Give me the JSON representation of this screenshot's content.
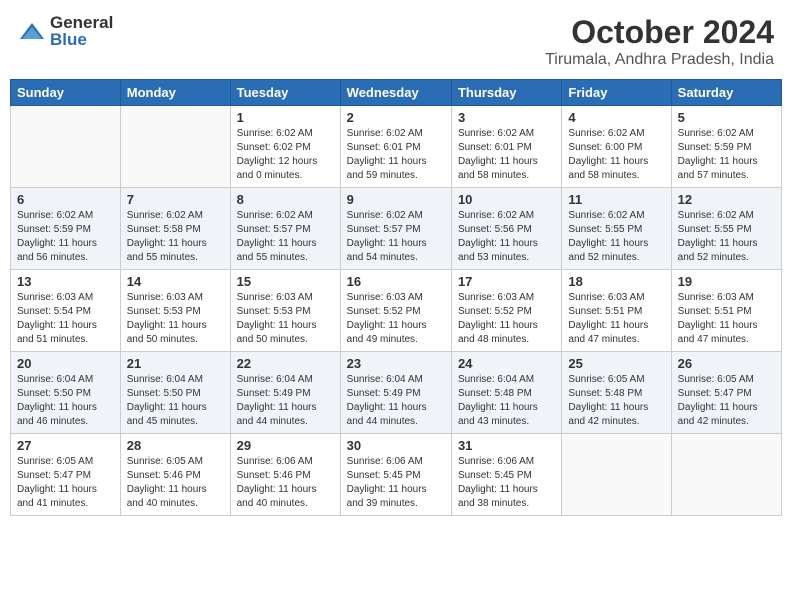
{
  "header": {
    "logo_general": "General",
    "logo_blue": "Blue",
    "month_title": "October 2024",
    "location": "Tirumala, Andhra Pradesh, India"
  },
  "weekdays": [
    "Sunday",
    "Monday",
    "Tuesday",
    "Wednesday",
    "Thursday",
    "Friday",
    "Saturday"
  ],
  "weeks": [
    [
      {
        "day": "",
        "info": ""
      },
      {
        "day": "",
        "info": ""
      },
      {
        "day": "1",
        "info": "Sunrise: 6:02 AM\nSunset: 6:02 PM\nDaylight: 12 hours\nand 0 minutes."
      },
      {
        "day": "2",
        "info": "Sunrise: 6:02 AM\nSunset: 6:01 PM\nDaylight: 11 hours\nand 59 minutes."
      },
      {
        "day": "3",
        "info": "Sunrise: 6:02 AM\nSunset: 6:01 PM\nDaylight: 11 hours\nand 58 minutes."
      },
      {
        "day": "4",
        "info": "Sunrise: 6:02 AM\nSunset: 6:00 PM\nDaylight: 11 hours\nand 58 minutes."
      },
      {
        "day": "5",
        "info": "Sunrise: 6:02 AM\nSunset: 5:59 PM\nDaylight: 11 hours\nand 57 minutes."
      }
    ],
    [
      {
        "day": "6",
        "info": "Sunrise: 6:02 AM\nSunset: 5:59 PM\nDaylight: 11 hours\nand 56 minutes."
      },
      {
        "day": "7",
        "info": "Sunrise: 6:02 AM\nSunset: 5:58 PM\nDaylight: 11 hours\nand 55 minutes."
      },
      {
        "day": "8",
        "info": "Sunrise: 6:02 AM\nSunset: 5:57 PM\nDaylight: 11 hours\nand 55 minutes."
      },
      {
        "day": "9",
        "info": "Sunrise: 6:02 AM\nSunset: 5:57 PM\nDaylight: 11 hours\nand 54 minutes."
      },
      {
        "day": "10",
        "info": "Sunrise: 6:02 AM\nSunset: 5:56 PM\nDaylight: 11 hours\nand 53 minutes."
      },
      {
        "day": "11",
        "info": "Sunrise: 6:02 AM\nSunset: 5:55 PM\nDaylight: 11 hours\nand 52 minutes."
      },
      {
        "day": "12",
        "info": "Sunrise: 6:02 AM\nSunset: 5:55 PM\nDaylight: 11 hours\nand 52 minutes."
      }
    ],
    [
      {
        "day": "13",
        "info": "Sunrise: 6:03 AM\nSunset: 5:54 PM\nDaylight: 11 hours\nand 51 minutes."
      },
      {
        "day": "14",
        "info": "Sunrise: 6:03 AM\nSunset: 5:53 PM\nDaylight: 11 hours\nand 50 minutes."
      },
      {
        "day": "15",
        "info": "Sunrise: 6:03 AM\nSunset: 5:53 PM\nDaylight: 11 hours\nand 50 minutes."
      },
      {
        "day": "16",
        "info": "Sunrise: 6:03 AM\nSunset: 5:52 PM\nDaylight: 11 hours\nand 49 minutes."
      },
      {
        "day": "17",
        "info": "Sunrise: 6:03 AM\nSunset: 5:52 PM\nDaylight: 11 hours\nand 48 minutes."
      },
      {
        "day": "18",
        "info": "Sunrise: 6:03 AM\nSunset: 5:51 PM\nDaylight: 11 hours\nand 47 minutes."
      },
      {
        "day": "19",
        "info": "Sunrise: 6:03 AM\nSunset: 5:51 PM\nDaylight: 11 hours\nand 47 minutes."
      }
    ],
    [
      {
        "day": "20",
        "info": "Sunrise: 6:04 AM\nSunset: 5:50 PM\nDaylight: 11 hours\nand 46 minutes."
      },
      {
        "day": "21",
        "info": "Sunrise: 6:04 AM\nSunset: 5:50 PM\nDaylight: 11 hours\nand 45 minutes."
      },
      {
        "day": "22",
        "info": "Sunrise: 6:04 AM\nSunset: 5:49 PM\nDaylight: 11 hours\nand 44 minutes."
      },
      {
        "day": "23",
        "info": "Sunrise: 6:04 AM\nSunset: 5:49 PM\nDaylight: 11 hours\nand 44 minutes."
      },
      {
        "day": "24",
        "info": "Sunrise: 6:04 AM\nSunset: 5:48 PM\nDaylight: 11 hours\nand 43 minutes."
      },
      {
        "day": "25",
        "info": "Sunrise: 6:05 AM\nSunset: 5:48 PM\nDaylight: 11 hours\nand 42 minutes."
      },
      {
        "day": "26",
        "info": "Sunrise: 6:05 AM\nSunset: 5:47 PM\nDaylight: 11 hours\nand 42 minutes."
      }
    ],
    [
      {
        "day": "27",
        "info": "Sunrise: 6:05 AM\nSunset: 5:47 PM\nDaylight: 11 hours\nand 41 minutes."
      },
      {
        "day": "28",
        "info": "Sunrise: 6:05 AM\nSunset: 5:46 PM\nDaylight: 11 hours\nand 40 minutes."
      },
      {
        "day": "29",
        "info": "Sunrise: 6:06 AM\nSunset: 5:46 PM\nDaylight: 11 hours\nand 40 minutes."
      },
      {
        "day": "30",
        "info": "Sunrise: 6:06 AM\nSunset: 5:45 PM\nDaylight: 11 hours\nand 39 minutes."
      },
      {
        "day": "31",
        "info": "Sunrise: 6:06 AM\nSunset: 5:45 PM\nDaylight: 11 hours\nand 38 minutes."
      },
      {
        "day": "",
        "info": ""
      },
      {
        "day": "",
        "info": ""
      }
    ]
  ]
}
